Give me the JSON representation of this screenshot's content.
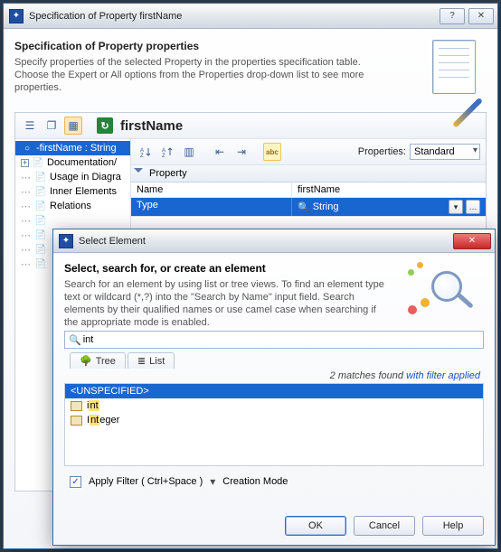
{
  "win1": {
    "title": "Specification of Property firstName",
    "header": {
      "title": "Specification of Property properties",
      "desc": "Specify properties of the selected Property in the properties specification table. Choose the Expert or All options from the Properties drop-down list to see more properties."
    },
    "property_name": "firstName",
    "tree": {
      "n0": "-firstName : String",
      "n1": "Documentation/",
      "n2": "Usage in Diagra",
      "n3": "Inner Elements",
      "n4": "Relations"
    },
    "right": {
      "properties_label": "Properties:",
      "properties_value": "Standard",
      "group": "Property",
      "row_name_label": "Name",
      "row_name_value": "firstName",
      "row_type_label": "Type",
      "row_type_value": "String"
    }
  },
  "win2": {
    "title": "Select Element",
    "header": {
      "title": "Select, search for, or create an element",
      "desc": "Search for an element by using list or tree views. To find an element type text or wildcard (*,?) into the \"Search by Name\" input field. Search elements by their qualified names or use camel case when searching if the appropriate mode is enabled."
    },
    "search_value": "int",
    "tabs": {
      "tree": "Tree",
      "list": "List"
    },
    "matches_text": "2 matches found ",
    "matches_filter": "with filter applied",
    "list": {
      "header": "<UNSPECIFIED>",
      "r1_pre": "i",
      "r1_hl": "nt",
      "r2_pre": "I",
      "r2_hl": "nt",
      "r2_post": "eger"
    },
    "filter": {
      "apply": "Apply Filter ( Ctrl+Space )",
      "creation": "Creation Mode"
    },
    "buttons": {
      "ok": "OK",
      "cancel": "Cancel",
      "help": "Help"
    }
  }
}
